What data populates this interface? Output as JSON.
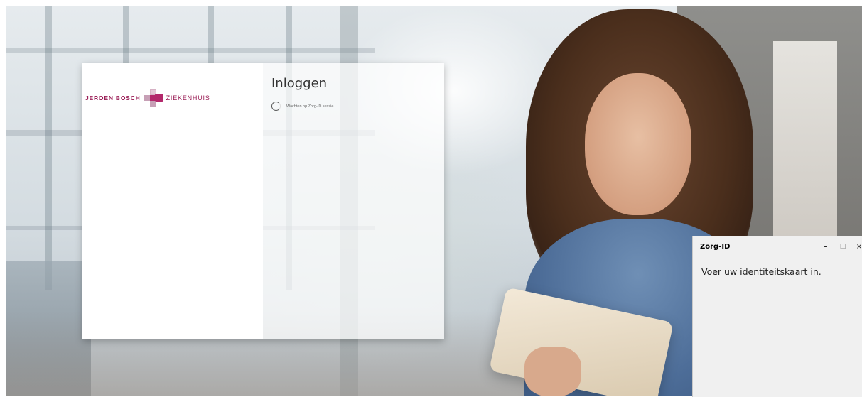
{
  "login": {
    "title": "Inloggen",
    "status": "Wachten op Zorg-ID sessie"
  },
  "logo": {
    "left_text": "JEROEN BOSCH",
    "right_text": "ZIEKENHUIS",
    "brand_color": "#9b1f57"
  },
  "zorg_window": {
    "title": "Zorg-ID",
    "message": "Voer uw identiteitskaart in.",
    "minimize_glyph": "–",
    "maximize_glyph": "□",
    "close_glyph": "×"
  }
}
